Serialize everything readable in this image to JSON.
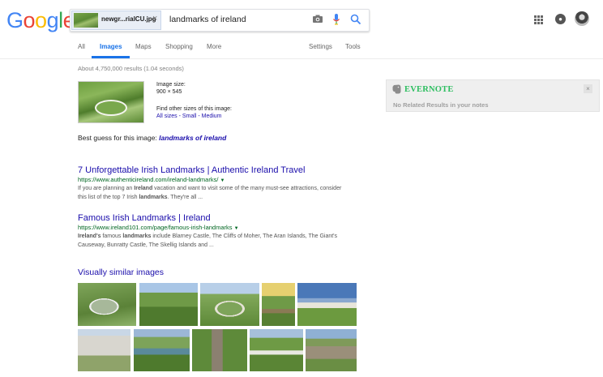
{
  "logo": {
    "letters": [
      "G",
      "o",
      "o",
      "g",
      "l",
      "e"
    ],
    "colors": [
      "#4285f4",
      "#ea4335",
      "#fbbc05",
      "#4285f4",
      "#34a853",
      "#ea4335"
    ]
  },
  "search": {
    "file_chip": "newgr...rialCU.jpg",
    "query": "landmarks of ireland"
  },
  "tabs": {
    "all": "All",
    "images": "Images",
    "maps": "Maps",
    "shopping": "Shopping",
    "more": "More",
    "settings": "Settings",
    "tools": "Tools"
  },
  "stats": "About 4,750,000 results (1.04 seconds)",
  "image_info": {
    "size_label": "Image size:",
    "size_value": "900 × 545",
    "other_sizes_label": "Find other sizes of this image:",
    "sizes_links": "All sizes - Small - Medium"
  },
  "best_guess": {
    "prefix": "Best guess for this image: ",
    "term": "landmarks of ireland"
  },
  "results": [
    {
      "title": "7 Unforgettable Irish Landmarks | Authentic Ireland Travel",
      "url": "https://www.authenticireland.com/ireland-landmarks/",
      "snippet_line1": "If you are planning an Ireland vacation and want to visit some of the many must-see attractions, consider",
      "snippet_line2": "this list of the top 7 Irish landmarks. They're all ..."
    },
    {
      "title": "Famous Irish Landmarks | Ireland",
      "url": "https://www.ireland101.com/page/famous-irish-landmarks",
      "snippet_line1": "Ireland's famous landmarks include Blarney Castle, The Cliffs of Moher, The Aran Islands, The Giant's",
      "snippet_line2": "Causeway, Bunratty Castle, The Skellig Islands and ..."
    }
  ],
  "similar": {
    "title": "Visually similar images"
  },
  "evernote": {
    "title": "EVERNOTE",
    "message": "No Related Results in your notes",
    "close": "×"
  },
  "colors": {
    "link": "#1a0dab",
    "url": "#006621",
    "accent": "#1a73e8",
    "evernote_green": "#2dbe60"
  },
  "icons": [
    "camera-icon",
    "microphone-icon",
    "search-icon",
    "apps-grid-icon",
    "notifications-icon",
    "close-icon",
    "dropdown-arrow-icon",
    "evernote-elephant-icon"
  ]
}
